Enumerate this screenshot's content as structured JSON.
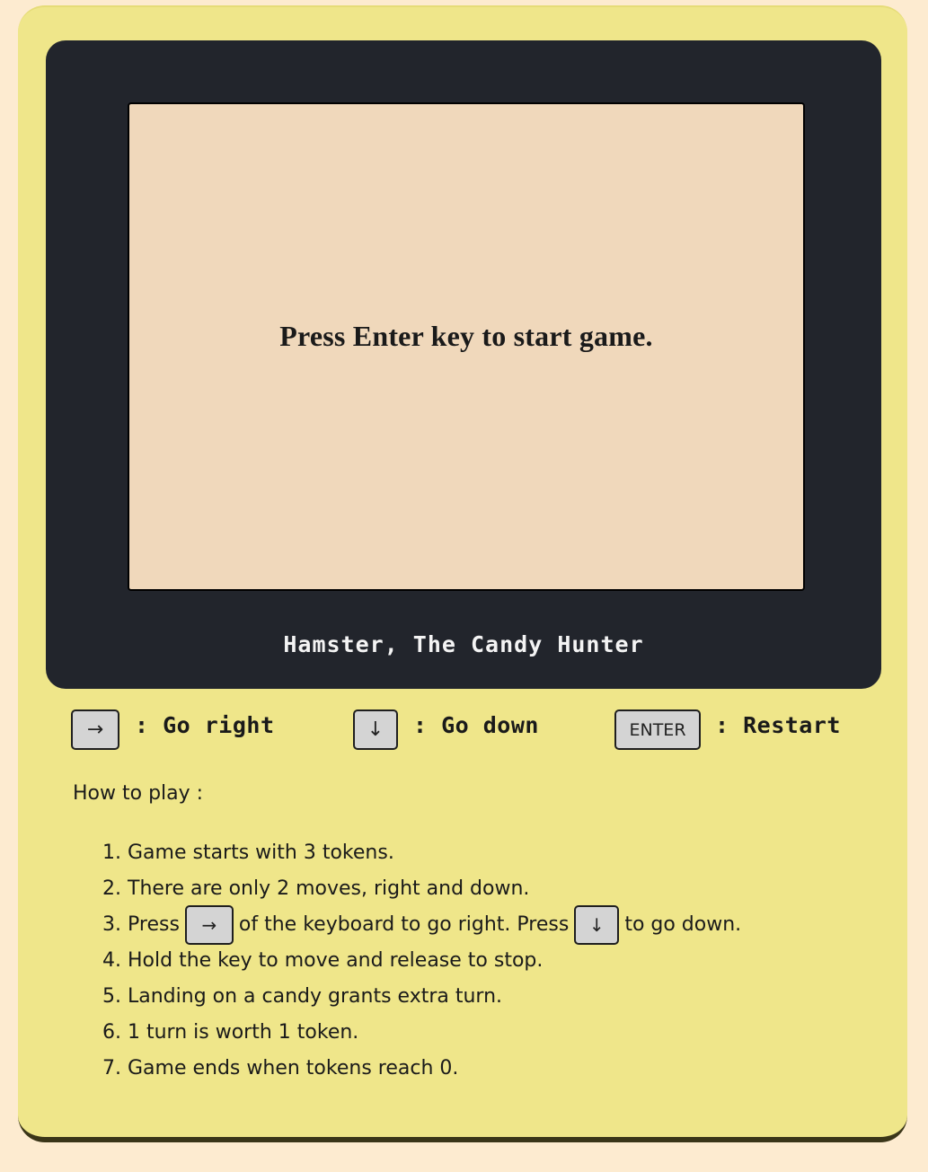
{
  "screen": {
    "message": "Press Enter key to start game."
  },
  "game": {
    "title": "Hamster, The Candy Hunter"
  },
  "controls": [
    {
      "key": "→",
      "label": ": Go right"
    },
    {
      "key": "↓",
      "label": ": Go down"
    },
    {
      "key": "ENTER",
      "label": ": Restart"
    }
  ],
  "instructions": {
    "heading": "How to play :",
    "steps": [
      {
        "num": "1.",
        "text": "Game starts with 3 tokens."
      },
      {
        "num": "2.",
        "text": "There are only 2 moves, right and down."
      },
      {
        "num": "3.",
        "pre": "Press",
        "key1": "→",
        "mid": "of the keyboard to go right. Press",
        "key2": "↓",
        "post": "to go down."
      },
      {
        "num": "4.",
        "text": "Hold the key to move and release to stop."
      },
      {
        "num": "5.",
        "text": "Landing on a candy grants extra turn."
      },
      {
        "num": "6.",
        "text": "1 turn is worth 1 token."
      },
      {
        "num": "7.",
        "text": "Game ends when tokens reach 0."
      }
    ]
  },
  "colors": {
    "page_bg": "#fdebd0",
    "console_body": "#efe68a",
    "bezel": "#22252c",
    "screen": "#f0d8bb",
    "key_bg": "#d4d4d4"
  }
}
